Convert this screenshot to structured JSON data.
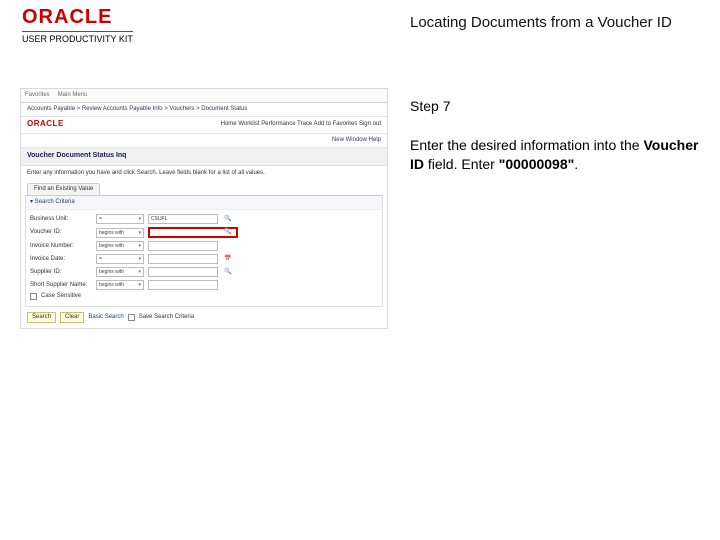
{
  "header": {
    "logo_text": "ORACLE",
    "logo_subtext": "USER PRODUCTIVITY KIT",
    "page_title": "Locating Documents from a Voucher ID"
  },
  "instruction": {
    "step_label": "Step 7",
    "line1_pre": "Enter the desired information into the ",
    "line1_bold": "Voucher ID",
    "line1_post": " field. Enter ",
    "line1_value": "\"00000098\"",
    "line1_end": "."
  },
  "app": {
    "top_tabs": [
      "Favorites",
      "Main Menu"
    ],
    "breadcrumb": "Accounts Payable  >  Review Accounts Payable Info  >  Vouchers  >  Document Status",
    "top_links": [
      "Home",
      "Worklist",
      "Performance Trace",
      "Add to Favorites",
      "Sign out"
    ],
    "brand": "ORACLE",
    "brand_right": [
      "New Window",
      "Help"
    ],
    "page_header": "Voucher Document Status Inq",
    "note": "Enter any information you have and click Search. Leave fields blank for a list of all values.",
    "tab_label": "Find an Existing Value",
    "section_title": "▾ Search Criteria",
    "fields": [
      {
        "label": "Business Unit:",
        "op": "=",
        "val": "CSUFL",
        "lookup": true,
        "highlight": false
      },
      {
        "label": "Voucher ID:",
        "op": "begins with",
        "val": "",
        "lookup": true,
        "highlight": true
      },
      {
        "label": "Invoice Number:",
        "op": "begins with",
        "val": "",
        "lookup": false,
        "highlight": false
      },
      {
        "label": "Invoice Date:",
        "op": "=",
        "val": "",
        "lookup": true,
        "highlight": false
      },
      {
        "label": "Supplier ID:",
        "op": "begins with",
        "val": "",
        "lookup": true,
        "highlight": false
      },
      {
        "label": "Short Supplier Name:",
        "op": "begins with",
        "val": "",
        "lookup": false,
        "highlight": false
      }
    ],
    "case_label": "Case Sensitive",
    "buttons": [
      "Search",
      "Clear",
      "Basic Search"
    ],
    "save_label": "Save Search Criteria"
  }
}
